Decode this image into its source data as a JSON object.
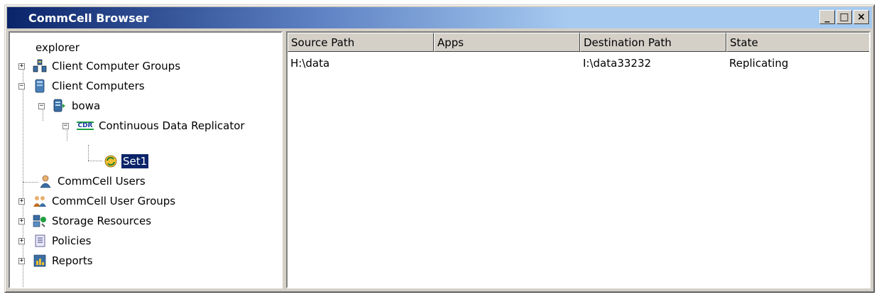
{
  "window": {
    "title": "CommCell Browser",
    "controls": {
      "minimize": "_",
      "maximize": "□",
      "close": "×"
    }
  },
  "tree": {
    "root": "explorer",
    "items": {
      "client_computer_groups": "Client Computer Groups",
      "client_computers": "Client Computers",
      "bowa": "bowa",
      "cdr_badge": "CDR",
      "continuous_data_replicator": "Continuous Data Replicator",
      "set1": "Set1",
      "commcell_users": "CommCell Users",
      "commcell_user_groups": "CommCell User Groups",
      "storage_resources": "Storage Resources",
      "policies": "Policies",
      "reports": "Reports"
    },
    "expanders": {
      "plus": "+",
      "minus": "−"
    }
  },
  "table": {
    "columns": [
      "Source Path",
      "Apps",
      "Destination Path",
      "State"
    ],
    "rows": [
      {
        "source_path": "H:\\data",
        "apps": "",
        "destination_path": "I:\\data33232",
        "state": "Replicating"
      }
    ]
  }
}
